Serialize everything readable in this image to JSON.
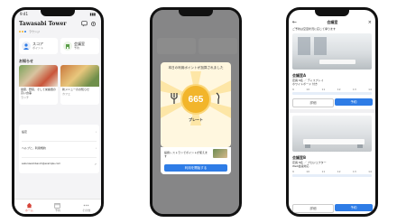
{
  "phone1": {
    "status_time": "9:41",
    "title": "Tawasabi Tower",
    "subtitle": "ラウンジ",
    "shortcuts": [
      {
        "label": "スコア",
        "sub": "ポイント",
        "icon": "person-icon"
      },
      {
        "label": "会議室",
        "sub": "予約",
        "icon": "chair-icon"
      }
    ],
    "news_heading": "お知らせ",
    "news": [
      {
        "title": "健康、野菜、そして栄養価の高い食事",
        "meta": "ランチ"
      },
      {
        "title": "新メニューのお知らせ",
        "meta": "カフェ"
      }
    ],
    "menu": [
      {
        "label": "設定",
        "icon": "gear-icon"
      },
      {
        "label": "ヘルプと、利用規約",
        "icon": "help-icon"
      },
      {
        "label": "sakuraworkbench@example.com",
        "icon": "mail-icon"
      }
    ],
    "tabs": [
      {
        "label": "ホーム",
        "icon": "home-icon"
      },
      {
        "label": "予約",
        "icon": "calendar-icon"
      },
      {
        "label": "その他",
        "icon": "more-icon"
      }
    ]
  },
  "phone2": {
    "modal_title": "本日の利用ポイントが加算されました",
    "points": "665",
    "rank_label": "プレート",
    "promo_text": "提携レストランでポイントが使えます",
    "confirm_button": "利用を開始する"
  },
  "phone3": {
    "header_title": "会議室",
    "notice": "ご予約は空室状況に応じて承ります",
    "rooms": [
      {
        "name": "会議室A",
        "details": [
          "定員 6名 ／ ディスプレイ",
          "ホワイトボード 付き"
        ],
        "slots": [
          "9",
          "10",
          "11",
          "12",
          "13",
          "14"
        ],
        "detail_button": "詳細",
        "book_button": "予約"
      },
      {
        "name": "会議室B",
        "details": [
          "定員 8名 ／ プロジェクター",
          "Web会議対応"
        ],
        "slots": [
          "9",
          "10",
          "11",
          "12",
          "13",
          "14"
        ],
        "detail_button": "詳細",
        "book_button": "予約"
      }
    ]
  },
  "colors": {
    "accent_blue": "#2e7ce6",
    "gold": "#f2b52b",
    "dark": "#222222"
  }
}
